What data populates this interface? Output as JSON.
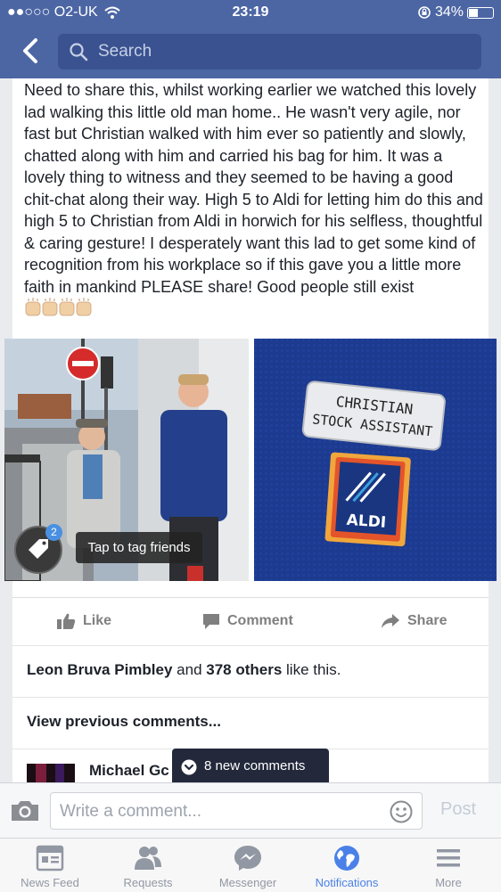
{
  "status_bar": {
    "carrier": "●●○○○ O2-UK",
    "time": "23:19",
    "battery": "34%"
  },
  "nav": {
    "search_placeholder": "Search"
  },
  "post": {
    "text": "Need to share this, whilst working earlier we watched this lovely lad walking this little old man home.. He wasn't very agile, nor fast but Christian walked with him ever so patiently and slowly, chatted along with him and carried his bag for him. It was a lovely thing to witness and they seemed to be having a good chit-chat along their way. High 5 to Aldi for letting him do this and high 5 to Christian from Aldi in horwich for his selfless, thoughtful & caring gesture! I desperately want this lad to get some kind of recognition from his workplace so if this gave you a little more faith in mankind PLEASE share! Good people still exist",
    "tag_count": "2",
    "tag_hint": "Tap to tag friends",
    "badge_name": "CHRISTIAN",
    "badge_role": "STOCK ASSISTANT",
    "aldi_logo": "ALDI"
  },
  "actions": {
    "like": "Like",
    "comment": "Comment",
    "share": "Share"
  },
  "likes": {
    "name": "Leon Bruva Pimbley",
    "connector": " and ",
    "others": "378 others",
    "suffix": " like this."
  },
  "comments": {
    "view_previous": "View previous comments...",
    "first_author": "Michael Gc",
    "new_comments": "8 new comments"
  },
  "composer": {
    "placeholder": "Write a comment...",
    "post_label": "Post"
  },
  "tabs": [
    {
      "label": "News Feed",
      "icon": "news-feed-icon",
      "active": false
    },
    {
      "label": "Requests",
      "icon": "friends-icon",
      "active": false
    },
    {
      "label": "Messenger",
      "icon": "messenger-icon",
      "active": false
    },
    {
      "label": "Notifications",
      "icon": "globe-icon",
      "active": true
    },
    {
      "label": "More",
      "icon": "menu-icon",
      "active": false
    }
  ],
  "colors": {
    "nav_blue": "#4c66a4",
    "search_bg": "#3b5290",
    "active_tab": "#4a80e8",
    "inactive": "#9197a3"
  }
}
